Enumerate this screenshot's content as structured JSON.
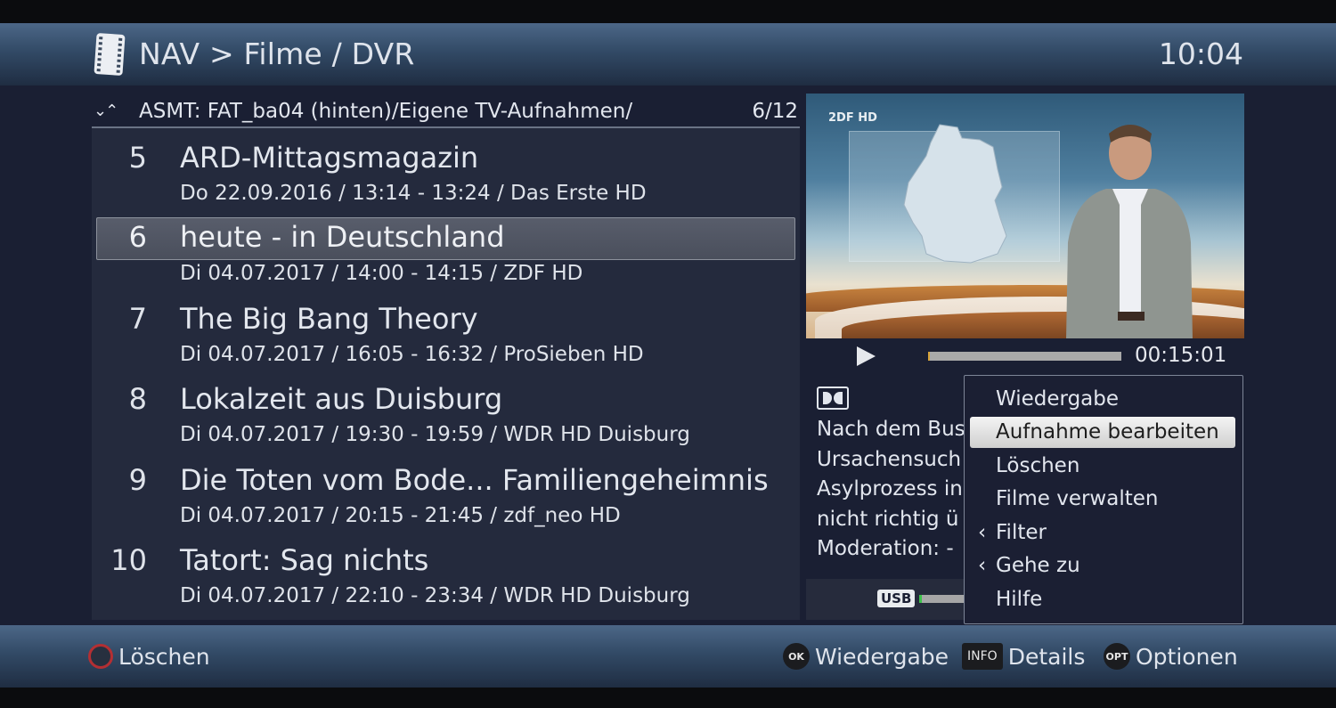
{
  "header": {
    "icon": "film-strip-icon",
    "title": "NAV > Filme / DVR",
    "clock": "10:04"
  },
  "path_bar": {
    "nav_arrows": "⌄⌃",
    "path": "ASMT: FAT_ba04 (hinten)/Eigene TV-Aufnahmen/",
    "position": "6/12"
  },
  "recordings": [
    {
      "num": "5",
      "title": "ARD-Mittagsmagazin",
      "meta": "Do 22.09.2016 / 13:14 - 13:24 / Das Erste HD",
      "selected": false
    },
    {
      "num": "6",
      "title": "heute - in Deutschland",
      "meta": "Di 04.07.2017 / 14:00 - 14:15 / ZDF HD",
      "selected": true
    },
    {
      "num": "7",
      "title": "The Big Bang Theory",
      "meta": "Di 04.07.2017 / 16:05 - 16:32 / ProSieben HD",
      "selected": false
    },
    {
      "num": "8",
      "title": "Lokalzeit aus Duisburg",
      "meta": "Di 04.07.2017 / 19:30 - 19:59 / WDR HD Duisburg",
      "selected": false
    },
    {
      "num": "9",
      "title": "Die Toten vom Bode... Familiengeheimnis",
      "meta": "Di 04.07.2017 / 20:15 - 21:45 / zdf_neo HD",
      "selected": false
    },
    {
      "num": "10",
      "title": "Tatort: Sag nichts",
      "meta": "Di 04.07.2017 / 22:10 - 23:34 / WDR HD Duisburg",
      "selected": false
    }
  ],
  "preview": {
    "channel_logo": "2DF HD",
    "playback_progress_percent": 1,
    "duration": "00:15:01",
    "audio_icon": "dolby-icon",
    "description_lines": [
      "Nach dem Bus",
      "Ursachensuch",
      "Asylprozess in",
      "nicht richtig ü",
      "Moderation: -"
    ],
    "storage_label": "USB",
    "storage_used_percent": 5
  },
  "options_menu": {
    "items": [
      {
        "label": "Wiedergabe",
        "submenu": false,
        "selected": false
      },
      {
        "label": "Aufnahme bearbeiten",
        "submenu": false,
        "selected": true
      },
      {
        "label": "Löschen",
        "submenu": false,
        "selected": false
      },
      {
        "label": "Filme verwalten",
        "submenu": false,
        "selected": false
      },
      {
        "label": "Filter",
        "submenu": true,
        "selected": false
      },
      {
        "label": "Gehe zu",
        "submenu": true,
        "selected": false
      },
      {
        "label": "Hilfe",
        "submenu": false,
        "selected": false
      }
    ],
    "submenu_glyph": "‹"
  },
  "footer": {
    "red": {
      "key": "",
      "label": "Löschen",
      "color": "#b32f33"
    },
    "ok": {
      "key": "OK",
      "label": "Wiedergabe"
    },
    "info": {
      "key": "INFO",
      "label": "Details"
    },
    "opt": {
      "key": "OPT",
      "label": "Optionen"
    }
  }
}
